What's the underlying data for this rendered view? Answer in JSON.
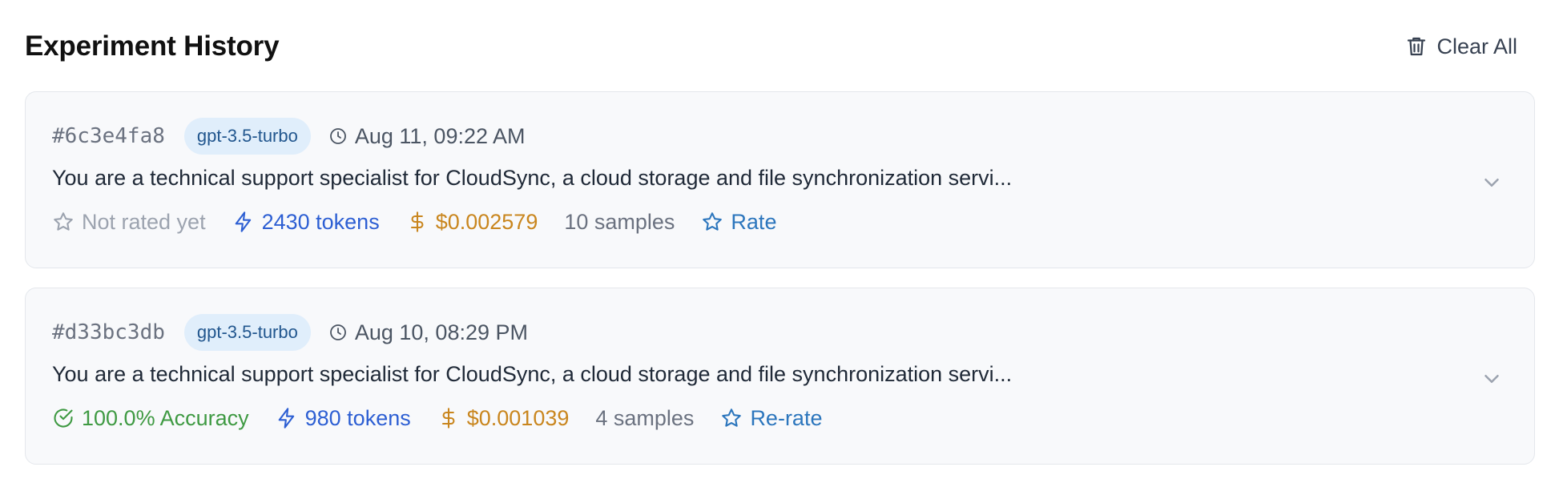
{
  "header": {
    "title": "Experiment History",
    "clear_label": "Clear All"
  },
  "colors": {
    "unrated": "#9ca3af",
    "accuracy": "#3f9a43",
    "tokens": "#2d5fd3",
    "cost": "#c9861e",
    "rate": "#2c76bd",
    "badge_bg": "#e0eefb"
  },
  "experiments": [
    {
      "id": "#6c3e4fa8",
      "model": "gpt-3.5-turbo",
      "timestamp": "Aug 11, 09:22 AM",
      "prompt": "You are a technical support specialist for CloudSync, a cloud storage and file synchronization servi...",
      "rating_status": "Not rated yet",
      "rating_icon": "star-outline-icon",
      "tokens": "2430 tokens",
      "cost": "$0.002579",
      "samples": "10 samples",
      "rate_label": "Rate"
    },
    {
      "id": "#d33bc3db",
      "model": "gpt-3.5-turbo",
      "timestamp": "Aug 10, 08:29 PM",
      "prompt": "You are a technical support specialist for CloudSync, a cloud storage and file synchronization servi...",
      "rating_status": "100.0% Accuracy",
      "rating_icon": "check-circle-icon",
      "tokens": "980 tokens",
      "cost": "$0.001039",
      "samples": "4 samples",
      "rate_label": "Re-rate"
    }
  ]
}
